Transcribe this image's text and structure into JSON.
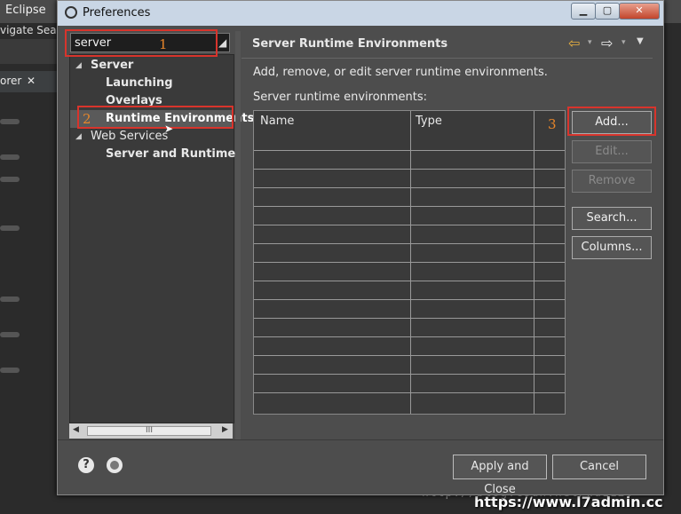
{
  "background": {
    "app_title": "Eclipse",
    "menu_partial": "vigate  Sea",
    "tab_partial": "orer",
    "tab_close": "✕"
  },
  "dialog": {
    "title": "Preferences",
    "filter": {
      "value": "server"
    },
    "tree": [
      {
        "label": "Server",
        "level": 0,
        "expanded": true,
        "bold": true
      },
      {
        "label": "Launching",
        "level": 1,
        "bold": true
      },
      {
        "label": "Overlays",
        "level": 1,
        "bold": true
      },
      {
        "label": "Runtime Environments",
        "level": 1,
        "bold": true,
        "selected": true
      },
      {
        "label": "Web Services",
        "level": 0,
        "expanded": true,
        "bold": false
      },
      {
        "label": "Server and Runtime",
        "level": 1,
        "bold": true
      }
    ],
    "page": {
      "title": "Server Runtime Environments",
      "description": "Add, remove, or edit server runtime environments.",
      "list_label": "Server runtime environments:",
      "columns": [
        "Name",
        "Type"
      ],
      "rows": 14
    },
    "buttons": {
      "add": "Add...",
      "edit": "Edit...",
      "remove": "Remove",
      "search": "Search...",
      "columns": "Columns...",
      "apply_close": "Apply and Close",
      "cancel": "Cancel"
    },
    "help_glyph": "?"
  },
  "annotations": {
    "one": "1",
    "two": "2",
    "three": "3"
  },
  "watermark": "http://blog.csdn.net/wu1126",
  "site": "https://www.l7admin.cc",
  "colors": {
    "annotation_red": "#d8342c",
    "annotation_number": "#e8862a",
    "nav_back": "#e8b040"
  }
}
